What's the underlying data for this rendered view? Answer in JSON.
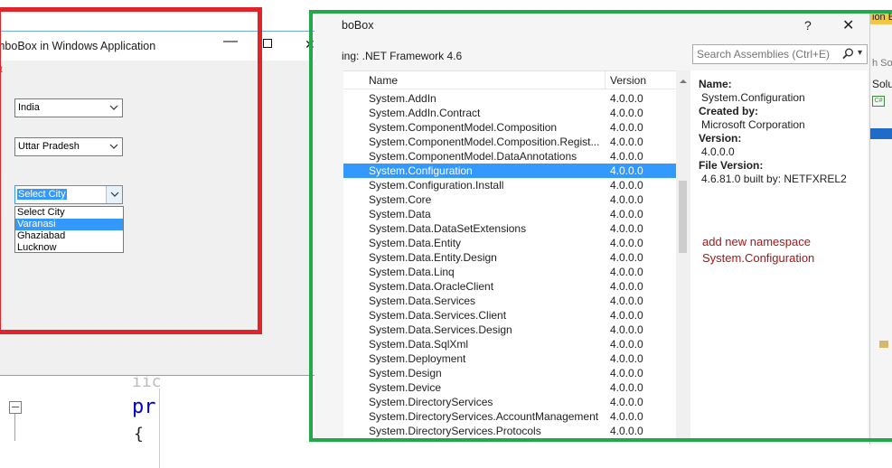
{
  "left_window": {
    "title": "mboBox in Windows Application",
    "title_buttons": {
      "minimize": "—",
      "close": "✕"
    },
    "marker": "t",
    "combos": [
      {
        "value": "India"
      },
      {
        "value": "Uttar Pradesh"
      },
      {
        "value": "Select City"
      }
    ],
    "dropdown_options": [
      "Select City",
      "Varanasi",
      "Ghaziabad",
      "Lucknow"
    ],
    "dropdown_selected_index": 1
  },
  "background_code": {
    "fragment_top": "iic",
    "fragment_keyword": "pr",
    "fragment_brace": "{"
  },
  "reference_dialog": {
    "title": "boBox",
    "help_label": "?",
    "close_label": "✕",
    "target_framework": "ing: .NET Framework 4.6",
    "search": {
      "placeholder": "Search Assemblies (Ctrl+E)"
    },
    "columns": {
      "name": "Name",
      "version": "Version"
    },
    "assemblies": [
      {
        "name": "System.AddIn",
        "version": "4.0.0.0"
      },
      {
        "name": "System.AddIn.Contract",
        "version": "4.0.0.0"
      },
      {
        "name": "System.ComponentModel.Composition",
        "version": "4.0.0.0"
      },
      {
        "name": "System.ComponentModel.Composition.Regist...",
        "version": "4.0.0.0"
      },
      {
        "name": "System.ComponentModel.DataAnnotations",
        "version": "4.0.0.0"
      },
      {
        "name": "System.Configuration",
        "version": "4.0.0.0"
      },
      {
        "name": "System.Configuration.Install",
        "version": "4.0.0.0"
      },
      {
        "name": "System.Core",
        "version": "4.0.0.0"
      },
      {
        "name": "System.Data",
        "version": "4.0.0.0"
      },
      {
        "name": "System.Data.DataSetExtensions",
        "version": "4.0.0.0"
      },
      {
        "name": "System.Data.Entity",
        "version": "4.0.0.0"
      },
      {
        "name": "System.Data.Entity.Design",
        "version": "4.0.0.0"
      },
      {
        "name": "System.Data.Linq",
        "version": "4.0.0.0"
      },
      {
        "name": "System.Data.OracleClient",
        "version": "4.0.0.0"
      },
      {
        "name": "System.Data.Services",
        "version": "4.0.0.0"
      },
      {
        "name": "System.Data.Services.Client",
        "version": "4.0.0.0"
      },
      {
        "name": "System.Data.Services.Design",
        "version": "4.0.0.0"
      },
      {
        "name": "System.Data.SqlXml",
        "version": "4.0.0.0"
      },
      {
        "name": "System.Deployment",
        "version": "4.0.0.0"
      },
      {
        "name": "System.Design",
        "version": "4.0.0.0"
      },
      {
        "name": "System.Device",
        "version": "4.0.0.0"
      },
      {
        "name": "System.DirectoryServices",
        "version": "4.0.0.0"
      },
      {
        "name": "System.DirectoryServices.AccountManagement",
        "version": "4.0.0.0"
      },
      {
        "name": "System.DirectoryServices.Protocols",
        "version": "4.0.0.0"
      }
    ],
    "selected_index": 5,
    "details": {
      "name_label": "Name:",
      "name_value": "System.Configuration",
      "created_by_label": "Created by:",
      "created_by_value": "Microsoft Corporation",
      "version_label": "Version:",
      "version_value": "4.0.0.0",
      "file_version_label": "File Version:",
      "file_version_value": "4.6.81.0 built by: NETFXREL2"
    },
    "annotation_line1": "add  new namespace",
    "annotation_line2": "System.Configuration"
  },
  "solution_explorer": {
    "title_fragment": "ion E",
    "search_fragment": "h So",
    "item_fragment": "Solu",
    "cs_badge": "C#"
  },
  "colors": {
    "red_highlight": "#e0242c",
    "green_highlight": "#22a94a",
    "selection": "#3399ff",
    "annotation": "#a01818"
  }
}
